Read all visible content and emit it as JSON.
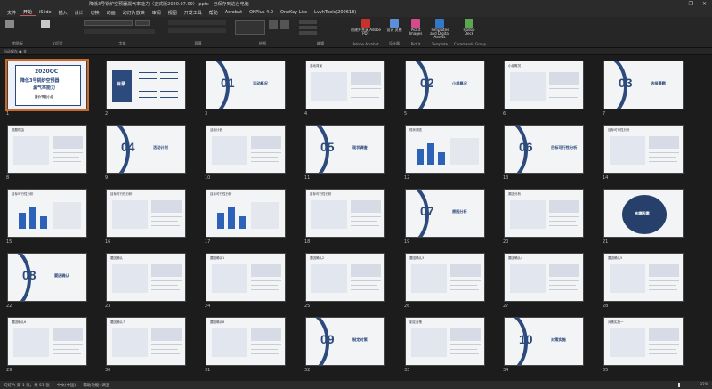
{
  "window": {
    "title": "降低3号锅炉空预器漏气率能力（正式版2020.07.09）.pptx - 已保存到这台电脑",
    "controls": [
      "—",
      "❐",
      "✕"
    ]
  },
  "tabs": [
    "文件",
    "开始",
    "iSlide",
    "插入",
    "设计",
    "切换",
    "动画",
    "幻灯片放映",
    "审阅",
    "视图",
    "开发工具",
    "帮助",
    "Acrobat",
    "OKPlus 4.0",
    "OneKey Lite",
    "LvyhTools(200618)"
  ],
  "active_tab": "开始",
  "ribbon": {
    "groups": [
      {
        "label": "剪贴板"
      },
      {
        "label": "幻灯片"
      },
      {
        "label": "字体"
      },
      {
        "label": "段落"
      },
      {
        "label": "绘图"
      },
      {
        "label": "编辑"
      },
      {
        "label": "Adobe Acrobat"
      },
      {
        "label": "设计器"
      },
      {
        "label": "Pickit"
      },
      {
        "label": "Template"
      },
      {
        "label": "Commands Group"
      }
    ],
    "buttons": {
      "pdf": "创建并共享 Adobe PDF",
      "designer": "设计 灵感",
      "pickit": "Pickit Images",
      "templates": "Templates and Digital Assets",
      "hadoo": "Hadoo Deck"
    }
  },
  "quickbar": "自动保存 ● 关",
  "slides": [
    {
      "n": "1",
      "kind": "cover",
      "t1": "2020QC",
      "t2": "降低3号锅炉空预器",
      "t3": "漏气率能力",
      "t4": "报价节能小组"
    },
    {
      "n": "2",
      "kind": "toc",
      "t1": "目录"
    },
    {
      "n": "3",
      "kind": "section",
      "num": "01",
      "label": "活动概况"
    },
    {
      "n": "4",
      "kind": "content",
      "head": "活动背景"
    },
    {
      "n": "5",
      "kind": "section",
      "num": "02",
      "label": "小组概况"
    },
    {
      "n": "6",
      "kind": "content",
      "head": "小组概况"
    },
    {
      "n": "7",
      "kind": "section",
      "num": "03",
      "label": "选择课题"
    },
    {
      "n": "8",
      "kind": "content",
      "head": "选题理由"
    },
    {
      "n": "9",
      "kind": "section",
      "num": "04",
      "label": "活动计划"
    },
    {
      "n": "10",
      "kind": "content",
      "head": "活动计划"
    },
    {
      "n": "11",
      "kind": "section",
      "num": "05",
      "label": "现状调查"
    },
    {
      "n": "12",
      "kind": "chart",
      "head": "现状调查"
    },
    {
      "n": "13",
      "kind": "section",
      "num": "06",
      "label": "目标可行性分析"
    },
    {
      "n": "14",
      "kind": "content",
      "head": "目标可行性分析"
    },
    {
      "n": "15",
      "kind": "chart",
      "head": "目标可行性分析"
    },
    {
      "n": "16",
      "kind": "content",
      "head": "目标可行性分析"
    },
    {
      "n": "17",
      "kind": "chart",
      "head": "目标可行性分析"
    },
    {
      "n": "18",
      "kind": "content",
      "head": "目标可行性分析"
    },
    {
      "n": "19",
      "kind": "section",
      "num": "07",
      "label": "原因分析"
    },
    {
      "n": "20",
      "kind": "content",
      "head": "原因分析"
    },
    {
      "n": "21",
      "kind": "dark",
      "head": "末端因素"
    },
    {
      "n": "22",
      "kind": "section",
      "num": "08",
      "label": "要因确认"
    },
    {
      "n": "23",
      "kind": "content",
      "head": "要因确认"
    },
    {
      "n": "24",
      "kind": "content",
      "head": "要因确认1"
    },
    {
      "n": "25",
      "kind": "content",
      "head": "要因确认2"
    },
    {
      "n": "26",
      "kind": "content",
      "head": "要因确认3"
    },
    {
      "n": "27",
      "kind": "content",
      "head": "要因确认4"
    },
    {
      "n": "28",
      "kind": "content",
      "head": "要因确认5"
    },
    {
      "n": "29",
      "kind": "content",
      "head": "要因确认6"
    },
    {
      "n": "30",
      "kind": "content",
      "head": "要因确认7"
    },
    {
      "n": "31",
      "kind": "content",
      "head": "要因确认8"
    },
    {
      "n": "32",
      "kind": "section",
      "num": "09",
      "label": "制定对策"
    },
    {
      "n": "33",
      "kind": "content",
      "head": "制定对策"
    },
    {
      "n": "34",
      "kind": "section",
      "num": "10",
      "label": "对策实施"
    },
    {
      "n": "35",
      "kind": "content",
      "head": "对策实施一"
    }
  ],
  "status": {
    "slide_info": "幻灯片 第 1 张，共 51 张",
    "language": "中文(中国)",
    "accessibility": "辅助功能: 调查",
    "zoom": "92%"
  }
}
